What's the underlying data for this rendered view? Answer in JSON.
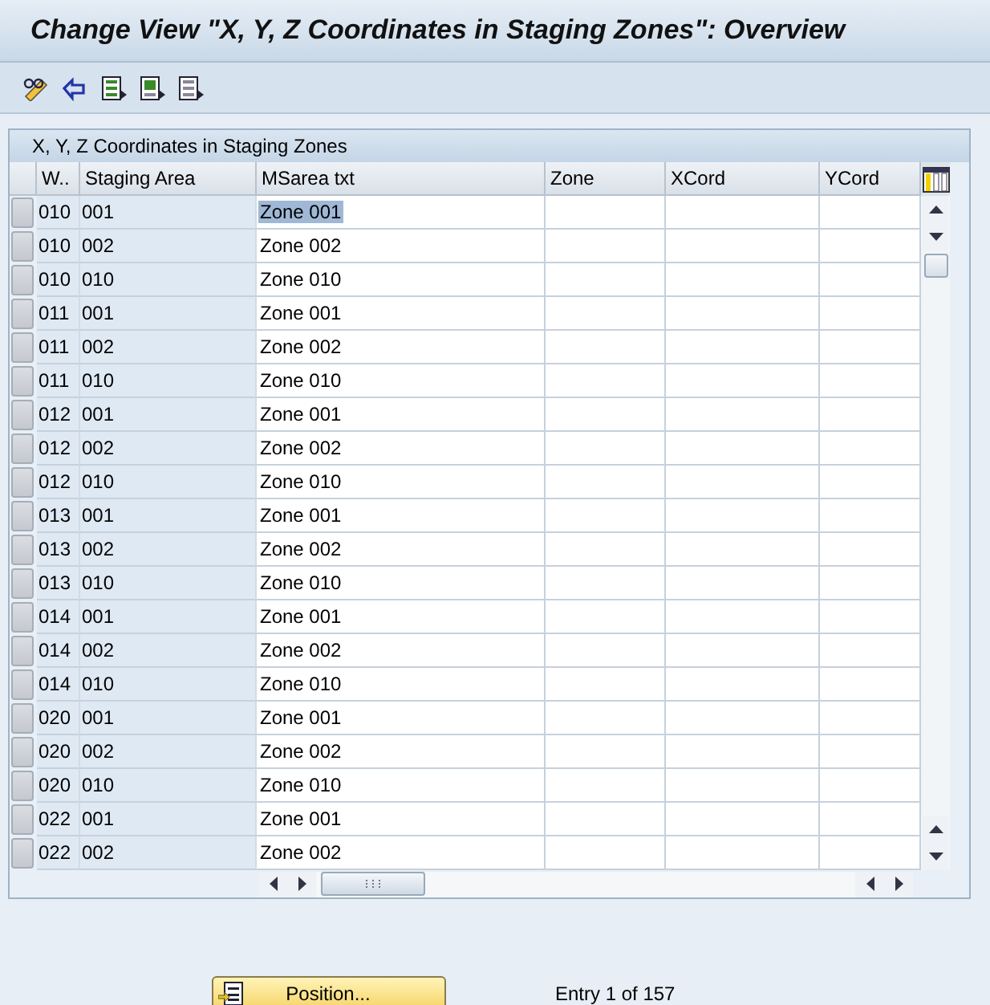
{
  "window": {
    "title": "Change View \"X, Y, Z Coordinates in Staging Zones\": Overview"
  },
  "toolbar": {
    "buttons": [
      {
        "kind": "change"
      },
      {
        "kind": "undo"
      },
      {
        "kind": "select-all"
      },
      {
        "kind": "select-block"
      },
      {
        "kind": "deselect-all"
      }
    ]
  },
  "table": {
    "title": "X, Y, Z Coordinates in Staging Zones",
    "columns": [
      "W..",
      "Staging Area",
      "MSarea txt",
      "Zone",
      "XCord",
      "YCord"
    ],
    "rows": [
      {
        "cells": [
          "010",
          "001",
          "Zone 001"
        ],
        "focused": true
      },
      {
        "cells": [
          "010",
          "002",
          "Zone 002"
        ],
        "focused": false
      },
      {
        "cells": [
          "010",
          "010",
          "Zone 010"
        ],
        "focused": false
      },
      {
        "cells": [
          "011",
          "001",
          "Zone 001"
        ],
        "focused": false
      },
      {
        "cells": [
          "011",
          "002",
          "Zone 002"
        ],
        "focused": false
      },
      {
        "cells": [
          "011",
          "010",
          "Zone 010"
        ],
        "focused": false
      },
      {
        "cells": [
          "012",
          "001",
          "Zone 001"
        ],
        "focused": false
      },
      {
        "cells": [
          "012",
          "002",
          "Zone 002"
        ],
        "focused": false
      },
      {
        "cells": [
          "012",
          "010",
          "Zone 010"
        ],
        "focused": false
      },
      {
        "cells": [
          "013",
          "001",
          "Zone 001"
        ],
        "focused": false
      },
      {
        "cells": [
          "013",
          "002",
          "Zone 002"
        ],
        "focused": false
      },
      {
        "cells": [
          "013",
          "010",
          "Zone 010"
        ],
        "focused": false
      },
      {
        "cells": [
          "014",
          "001",
          "Zone 001"
        ],
        "focused": false
      },
      {
        "cells": [
          "014",
          "002",
          "Zone 002"
        ],
        "focused": false
      },
      {
        "cells": [
          "014",
          "010",
          "Zone 010"
        ],
        "focused": false
      },
      {
        "cells": [
          "020",
          "001",
          "Zone 001"
        ],
        "focused": false
      },
      {
        "cells": [
          "020",
          "002",
          "Zone 002"
        ],
        "focused": false
      },
      {
        "cells": [
          "020",
          "010",
          "Zone 010"
        ],
        "focused": false
      },
      {
        "cells": [
          "022",
          "001",
          "Zone 001"
        ],
        "focused": false
      },
      {
        "cells": [
          "022",
          "002",
          "Zone 002"
        ],
        "focused": false
      }
    ]
  },
  "footer": {
    "position_button": "Position...",
    "entry_info": "Entry 1 of 157"
  }
}
